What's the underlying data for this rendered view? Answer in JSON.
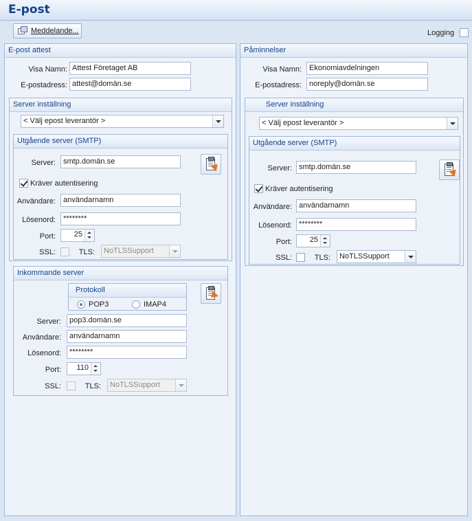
{
  "header": {
    "title": "E-post"
  },
  "toolbar": {
    "message_button": "Meddelande..."
  },
  "logging": {
    "label": "Logging",
    "checked": false
  },
  "left": {
    "title": "E-post attest",
    "display_name_label": "Visa Namn:",
    "display_name_value": "Attest Företaget AB",
    "email_label": "E-postadress:",
    "email_value": "attest@domän.se",
    "server_settings": {
      "title": "Server inställning",
      "provider": "< Välj epost leverantör >"
    },
    "smtp": {
      "title": "Utgående server (SMTP)",
      "server_label": "Server:",
      "server_value": "smtp.domän.se",
      "auth_label": "Kräver autentisering",
      "user_label": "Användare:",
      "user_value": "användarnamn",
      "password_label": "Lösenord:",
      "password_value": "********",
      "port_label": "Port:",
      "port_value": "25",
      "ssl_label": "SSL:",
      "tls_label": "TLS:",
      "tls_value": "NoTLSSupport"
    },
    "incoming": {
      "title": "Inkommande server",
      "protocol_title": "Protokoll",
      "pop3_label": "POP3",
      "imap4_label": "IMAP4",
      "server_label": "Server:",
      "server_value": "pop3.domän.se",
      "user_label": "Användare:",
      "user_value": "användarnamn",
      "password_label": "Lösenord:",
      "password_value": "********",
      "port_label": "Port:",
      "port_value": "110",
      "ssl_label": "SSL:",
      "tls_label": "TLS:",
      "tls_value": "NoTLSSupport"
    }
  },
  "right": {
    "title": "Påminnelser",
    "display_name_label": "Visa Namn:",
    "display_name_value": "Ekonomiavdelningen",
    "email_label": "E-postadress:",
    "email_value": "noreply@domän.se",
    "server_settings": {
      "title": "Server inställning",
      "provider": "< Välj epost leverantör >"
    },
    "smtp": {
      "title": "Utgående server (SMTP)",
      "server_label": "Server:",
      "server_value": "smtp.domän.se",
      "auth_label": "Kräver autentisering",
      "user_label": "Användare:",
      "user_value": "användarnamn",
      "password_label": "Lösenord:",
      "password_value": "********",
      "port_label": "Port:",
      "port_value": "25",
      "ssl_label": "SSL:",
      "tls_label": "TLS:",
      "tls_value": "NoTLSSupport"
    }
  },
  "icons": {
    "message": "message-icon",
    "test_send": "test-send-icon",
    "test_receive": "test-receive-icon"
  }
}
